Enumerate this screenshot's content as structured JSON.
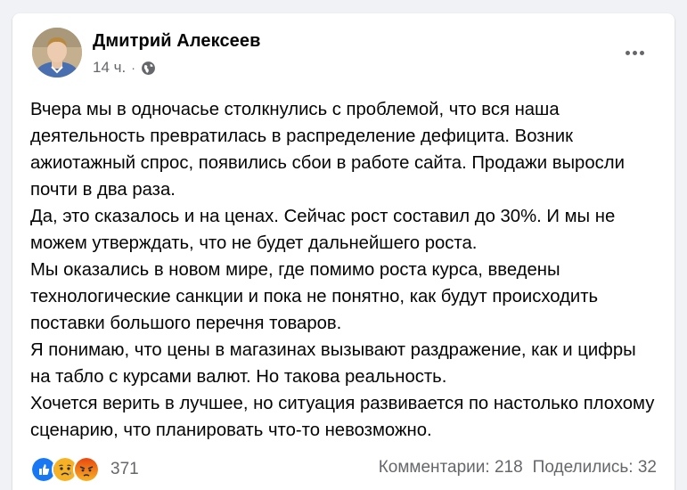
{
  "post": {
    "author": "Дмитрий Алексеев",
    "time": "14 ч.",
    "separator": "·",
    "privacy_icon": "globe-icon",
    "more_icon": "more-options-icon",
    "paragraphs": [
      "Вчера мы в одночасье столкнулись с проблемой, что вся наша деятельность превратилась в распределение дефицита. Возник ажиотажный спрос, появились сбои в работе сайта. Продажи выросли почти в два раза.",
      "Да, это сказалось и на ценах. Сейчас рост составил до 30%. И мы не можем утверждать, что не будет дальнейшего роста.",
      "Мы оказались в новом мире, где помимо роста курса, введены технологические санкции и пока не понятно, как будут происходить поставки большого перечня товаров.",
      "Я понимаю, что цены в магазинах вызывают раздражение, как и цифры на табло с курсами валют. Но такова реальность.",
      "Хочется верить в лучшее, но ситуация развивается по настолько плохому сценарию, что планировать что-то невозможно."
    ]
  },
  "footer": {
    "reactions": [
      "like-icon",
      "sad-icon",
      "angry-icon"
    ],
    "reaction_count": "371",
    "comments": "Комментарии: 218",
    "shares": "Поделились: 32"
  },
  "colors": {
    "like": "#1877f2",
    "sad": "#f7b125",
    "angry": "#e9710f",
    "secondary_text": "#65676b"
  }
}
